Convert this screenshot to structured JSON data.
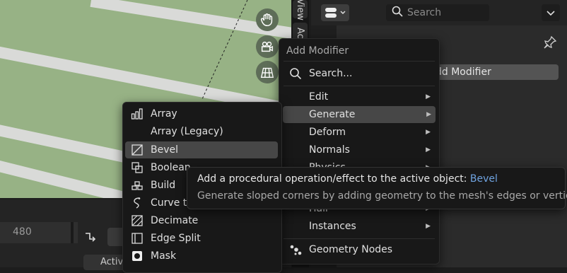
{
  "viewport": {
    "nav_buttons": [
      "hand-icon",
      "camera-icon",
      "grid-icon"
    ]
  },
  "sidebar_tabs": {
    "view": "View",
    "active": "Ac"
  },
  "right_panel": {
    "search_placeholder": "Search",
    "add_modifier_button": "dd Modifier",
    "title_fragment": "..."
  },
  "timeline": {
    "frame_number": "480",
    "active_label": "Activ"
  },
  "add_modifier_menu": {
    "title": "Add Modifier",
    "search_label": "Search...",
    "items": [
      {
        "label": "Edit",
        "submenu": true
      },
      {
        "label": "Generate",
        "submenu": true
      },
      {
        "label": "Deform",
        "submenu": true
      },
      {
        "label": "Normals",
        "submenu": true
      },
      {
        "label": "Physics",
        "submenu": true
      },
      {
        "label": "Hair",
        "submenu": true
      },
      {
        "label": "Instances",
        "submenu": true
      }
    ],
    "geometry_nodes_label": "Geometry Nodes"
  },
  "generate_submenu": {
    "items": [
      {
        "label": "Array",
        "icon": "array-icon"
      },
      {
        "label": "Array (Legacy)",
        "icon": ""
      },
      {
        "label": "Bevel",
        "icon": "bevel-icon"
      },
      {
        "label": "Boolean",
        "icon": "boolean-icon"
      },
      {
        "label": "Build",
        "icon": "build-icon"
      },
      {
        "label": "Curve to Tube",
        "icon": "curve-icon"
      },
      {
        "label": "Decimate",
        "icon": "decimate-icon"
      },
      {
        "label": "Edge Split",
        "icon": "edge-split-icon"
      },
      {
        "label": "Mask",
        "icon": "mask-icon"
      }
    ],
    "highlighted": "Bevel"
  },
  "tooltip": {
    "line1": "Add a procedural operation/effect to the active object:",
    "line1_highlight": "Bevel",
    "line2": "Generate sloped corners by adding geometry to the mesh's edges or vertices"
  },
  "colors": {
    "highlight_text": "#6fa3e0",
    "menu_bg": "#181818",
    "viewport_grass": "#97b285"
  }
}
